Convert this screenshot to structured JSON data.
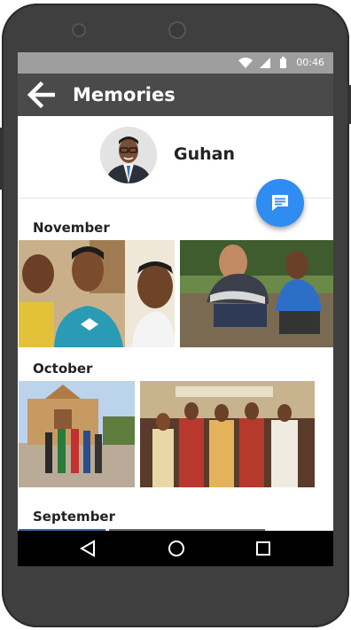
{
  "status_bar": {
    "time": "00:46"
  },
  "app_bar": {
    "title": "Memories",
    "back_icon": "arrow-back-icon"
  },
  "profile": {
    "name": "Guhan",
    "avatar": "profile-photo"
  },
  "fab": {
    "icon": "chat-message-icon",
    "color": "#2f8cf0"
  },
  "sections": [
    {
      "label": "November",
      "photos": [
        "photo-group-selfie",
        "photo-outdoor-crouching"
      ]
    },
    {
      "label": "October",
      "photos": [
        "photo-campus-church",
        "photo-group-traditional"
      ]
    },
    {
      "label": "September",
      "photos": [
        "photo-september-1",
        "photo-september-2"
      ]
    }
  ],
  "nav_bar": {
    "icons": [
      "back-triangle-icon",
      "home-circle-icon",
      "recents-square-icon"
    ]
  },
  "colors": {
    "app_bar": "#4a4a4a",
    "status_bar": "#9e9e9e",
    "phone_body": "#3f3f3f",
    "accent": "#2f8cf0"
  }
}
